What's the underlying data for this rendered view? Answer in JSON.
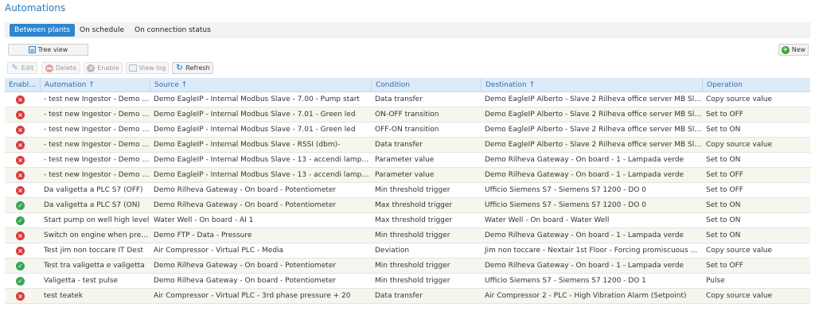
{
  "page": {
    "title": "Automations"
  },
  "tabs": [
    {
      "label": "Between plants",
      "active": true
    },
    {
      "label": "On schedule",
      "active": false
    },
    {
      "label": "On connection status",
      "active": false
    }
  ],
  "toolbar": {
    "tree_view_label": "Tree view",
    "new_label": "New",
    "edit_label": "Edit",
    "delete_label": "Delete",
    "enable_label": "Enable",
    "view_log_label": "View log",
    "refresh_label": "Refresh"
  },
  "colors": {
    "accent": "#2e86cf",
    "enabled": "#3aa655",
    "disabled": "#d83a3a",
    "header_bg": "#ddeaf7"
  },
  "table": {
    "columns": [
      "Enabl...",
      "Automation ↑",
      "Source ↑",
      "Condition",
      "Destination ↑",
      "Operation"
    ],
    "rows": [
      {
        "enabled": false,
        "automation": "- test new Ingestor - Demo E...",
        "source": "Demo EagleIP - Internal Modbus Slave - 7.00 - Pump start",
        "condition": "Data transfer",
        "destination": "Demo EagleIP Alberto - Slave 2 Rilheva office server MB Slave - ...",
        "operation": "Copy source value"
      },
      {
        "enabled": false,
        "automation": "- test new Ingestor - Demo E...",
        "source": "Demo EagleIP - Internal Modbus Slave - 7.01 - Green led",
        "condition": "ON-OFF transition",
        "destination": "Demo EagleIP Alberto - Slave 2 Rilheva office server MB Slave - ...",
        "operation": "Set to OFF"
      },
      {
        "enabled": false,
        "automation": "- test new Ingestor - Demo E...",
        "source": "Demo EagleIP - Internal Modbus Slave - 7.01 - Green led",
        "condition": "OFF-ON transition",
        "destination": "Demo EagleIP Alberto - Slave 2 Rilheva office server MB Slave - ...",
        "operation": "Set to ON"
      },
      {
        "enabled": false,
        "automation": "- test new Ingestor - Demo E...",
        "source": "Demo EagleIP - Internal Modbus Slave - RSSI (dbm)-",
        "condition": "Data transfer",
        "destination": "Demo EagleIP Alberto - Slave 2 Rilheva office server MB Slave - ...",
        "operation": "Copy source value"
      },
      {
        "enabled": false,
        "automation": "- test new Ingestor - Demo E...",
        "source": "Demo EagleIP - Internal Modbus Slave - 13 - accendi lampada v...",
        "condition": "Parameter value",
        "destination": "Demo Rilheva Gateway - On board - 1 - Lampada verde",
        "operation": "Set to ON"
      },
      {
        "enabled": false,
        "automation": "- test new Ingestor - Demo E...",
        "source": "Demo EagleIP - Internal Modbus Slave - 13 - accendi lampada v...",
        "condition": "Parameter value",
        "destination": "Demo Rilheva Gateway - On board - 1 - Lampada verde",
        "operation": "Set to OFF"
      },
      {
        "enabled": false,
        "automation": "Da valigetta a PLC S7 (OFF)",
        "source": "Demo Rilheva Gateway - On board - Potentiometer",
        "condition": "Min threshold trigger",
        "destination": "Ufficio Siemens S7 - Siemens S7 1200 - DO 0",
        "operation": "Set to OFF"
      },
      {
        "enabled": true,
        "automation": "Da valigetta a PLC S7 (ON)",
        "source": "Demo Rilheva Gateway - On board - Potentiometer",
        "condition": "Max threshold trigger",
        "destination": "Ufficio Siemens S7 - Siemens S7 1200 - DO 0",
        "operation": "Set to ON"
      },
      {
        "enabled": true,
        "automation": "Start pump on well high level",
        "source": "Water Well - On board - AI 1",
        "condition": "Max threshold trigger",
        "destination": "Water Well - On board - Water Well",
        "operation": "Set to ON"
      },
      {
        "enabled": false,
        "automation": "Switch on engine when press...",
        "source": "Demo FTP - Data - Pressure",
        "condition": "Min threshold trigger",
        "destination": "Demo Rilheva Gateway - On board - 1 - Lampada verde",
        "operation": "Set to ON"
      },
      {
        "enabled": false,
        "automation": "Test jim non toccare IT Dest",
        "source": "Air Compressor - Virtual PLC - Media",
        "condition": "Deviation",
        "destination": "Jim non toccare - Nextair 1st Floor - Forcing promiscuous batter...",
        "operation": "Copy source value"
      },
      {
        "enabled": true,
        "automation": "Test tra valigetta e valigetta",
        "source": "Demo Rilheva Gateway - On board - Potentiometer",
        "condition": "Min threshold trigger",
        "destination": "Demo Rilheva Gateway - On board - 1 - Lampada verde",
        "operation": "Set to OFF"
      },
      {
        "enabled": true,
        "automation": "Valigetta - test pulse",
        "source": "Demo Rilheva Gateway - On board - Potentiometer",
        "condition": "Min threshold trigger",
        "destination": "Ufficio Siemens S7 - Siemens S7 1200 - DO 1",
        "operation": "Pulse"
      },
      {
        "enabled": false,
        "automation": "test teatek",
        "source": "Air Compressor - Virtual PLC - 3rd phase pressure + 20",
        "condition": "Data transfer",
        "destination": "Air Compressor 2 - PLC - High Vibration Alarm (Setpoint)",
        "operation": "Copy source value"
      }
    ]
  }
}
